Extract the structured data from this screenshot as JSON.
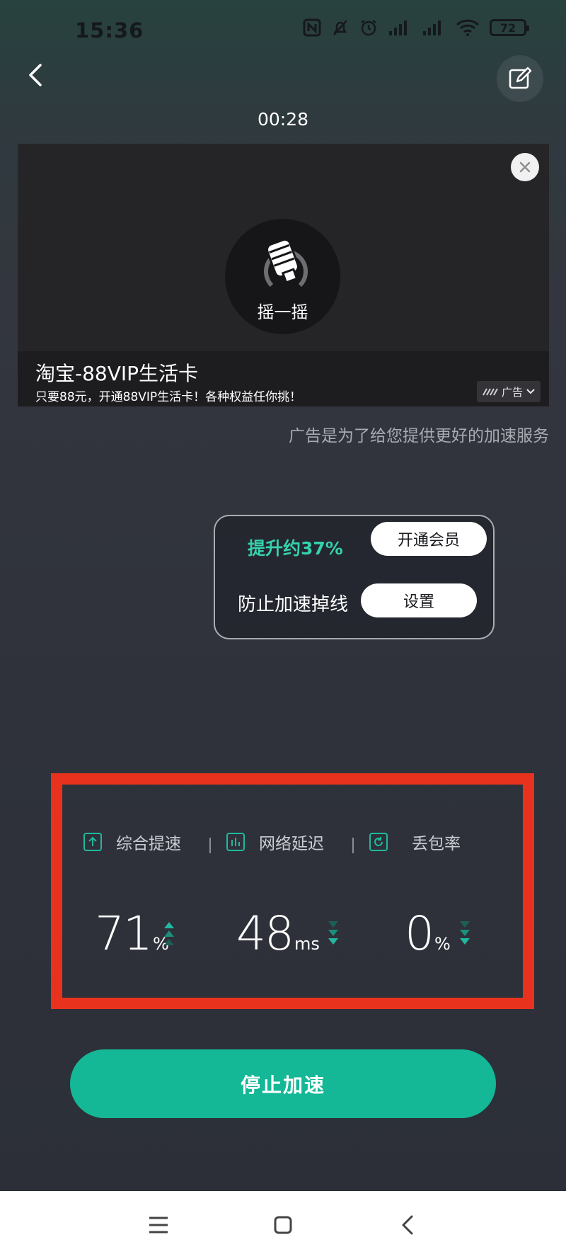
{
  "status_bar": {
    "time": "15:36",
    "battery": "72"
  },
  "header": {
    "timer": "00:28",
    "icons": [
      "back-arrow-icon",
      "edit-icon"
    ]
  },
  "ad": {
    "shake_label": "摇一摇",
    "title": "淘宝-88VIP生活卡",
    "description": "只要88元，开通88VIP生活卡！各种权益任你挑！",
    "badge_label": "广告",
    "note": "广告是为了给您提供更好的加速服务"
  },
  "boost_card": {
    "boost_text": "提升约37%",
    "vip_button": "开通会员",
    "anti_drop_text": "防止加速掉线",
    "settings_button": "设置"
  },
  "stats": [
    {
      "label": "综合提速",
      "value": "71",
      "unit": "%",
      "trend": "up",
      "icon": "arrow-up-box-icon"
    },
    {
      "label": "网络延迟",
      "value": "48",
      "unit": "ms",
      "trend": "down",
      "icon": "bar-chart-icon"
    },
    {
      "label": "丢包率",
      "value": "0",
      "unit": "%",
      "trend": "down",
      "icon": "refresh-icon"
    }
  ],
  "stop_button": "停止加速",
  "colors": {
    "accent": "#14b796",
    "highlight_box": "#e8321d",
    "boost_text": "#35d1ad"
  }
}
